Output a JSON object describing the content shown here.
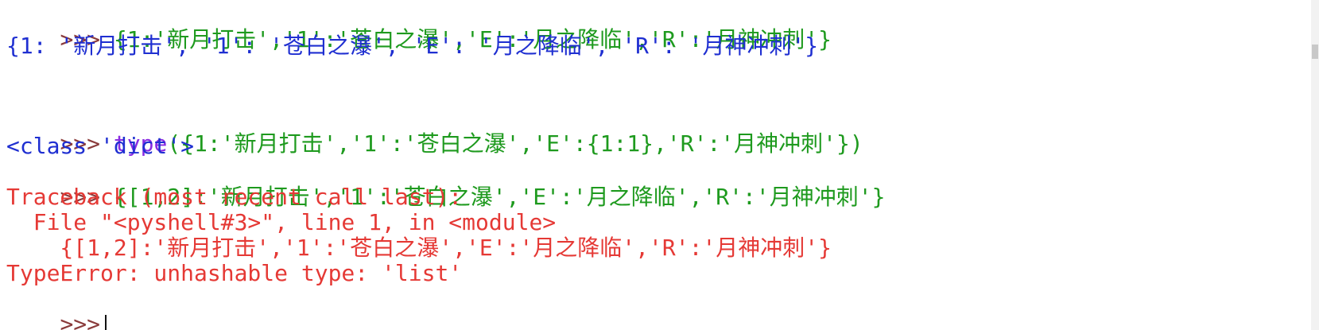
{
  "colors": {
    "prompt": "#8a3b3b",
    "string": "#1e9a1e",
    "builtin": "#8a2be2",
    "output": "#1f2fd1",
    "error": "#e53935",
    "background": "#ffffff"
  },
  "shell": {
    "lines": [
      {
        "prompt": ">>>",
        "code": " {1:'新月打击','1':'苍白之瀑','E':'月之降临','R':'月神冲刺'}"
      },
      {
        "output": "{1: '新月打击', '1': '苍白之瀑', 'E': '月之降临', 'R': '月神冲刺'}"
      },
      {
        "prompt": ">>>",
        "call_name": " type",
        "call_args": "({1:'新月打击','1':'苍白之瀑','E':{1:1},'R':'月神冲刺'})"
      },
      {
        "output": "<class 'dict'>"
      },
      {
        "prompt": ">>>",
        "code": " {[1,2]:'新月打击','1':'苍白之瀑','E':'月之降临','R':'月神冲刺'}"
      },
      {
        "error": "Traceback (most recent call last):"
      },
      {
        "error": "  File \"<pyshell#3>\", line 1, in <module>"
      },
      {
        "error": "    {[1,2]:'新月打击','1':'苍白之瀑','E':'月之降临','R':'月神冲刺'}"
      },
      {
        "error": "TypeError: unhashable type: 'list'"
      },
      {
        "prompt": ">>>"
      }
    ]
  }
}
